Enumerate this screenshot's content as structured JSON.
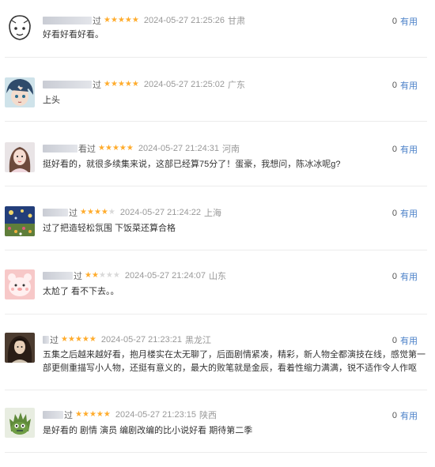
{
  "comments": [
    {
      "user_suffix": "过",
      "rating": 5,
      "time": "2024-05-27 21:25:26",
      "location": "甘肃",
      "text": "好看好看好看。",
      "likes": "0",
      "like_label": "有用",
      "avatar": "sketch-face-avatar"
    },
    {
      "user_suffix": "过",
      "rating": 5,
      "time": "2024-05-27 21:25:02",
      "location": "广东",
      "text": "上头",
      "likes": "0",
      "like_label": "有用",
      "avatar": "anime-boy-avatar"
    },
    {
      "user_suffix": "看过",
      "rating": 5,
      "time": "2024-05-27 21:24:31",
      "location": "河南",
      "text": "挺好看的，就很多续集来说，这部已经算75分了！蛋豪，我想问，陈冰冰呢g?",
      "likes": "0",
      "like_label": "有用",
      "avatar": "girl-photo-avatar"
    },
    {
      "user_suffix": "过",
      "rating": 4,
      "time": "2024-05-27 21:24:22",
      "location": "上海",
      "text": "过了把造轻松氛围 下饭菜还算合格",
      "likes": "0",
      "like_label": "有用",
      "avatar": "painting-avatar"
    },
    {
      "user_suffix": "过",
      "rating": 2,
      "time": "2024-05-27 21:24:07",
      "location": "山东",
      "text": "太尬了 看不下去。。",
      "likes": "0",
      "like_label": "有用",
      "avatar": "pink-bear-avatar"
    },
    {
      "user_suffix": "过",
      "rating": 5,
      "time": "2024-05-27 21:23:21",
      "location": "黑龙江",
      "text": "五集之后越来越好看，抱月楼实在太无聊了，后面剧情紧凑，精彩，新人物全都演技在线，感觉第一部更侧重描写小人物，还挺有意义的，最大的败笔就是金辰，看着性缩力满满，锐不适作令人作呕",
      "likes": "0",
      "like_label": "有用",
      "avatar": "long-hair-avatar"
    },
    {
      "user_suffix": "过",
      "rating": 5,
      "time": "2024-05-27 21:23:15",
      "location": "陕西",
      "text": "是好看的 剧情 演员 编剧改编的比小说好看 期待第二季",
      "likes": "0",
      "like_label": "有用",
      "avatar": "green-monster-avatar"
    }
  ]
}
